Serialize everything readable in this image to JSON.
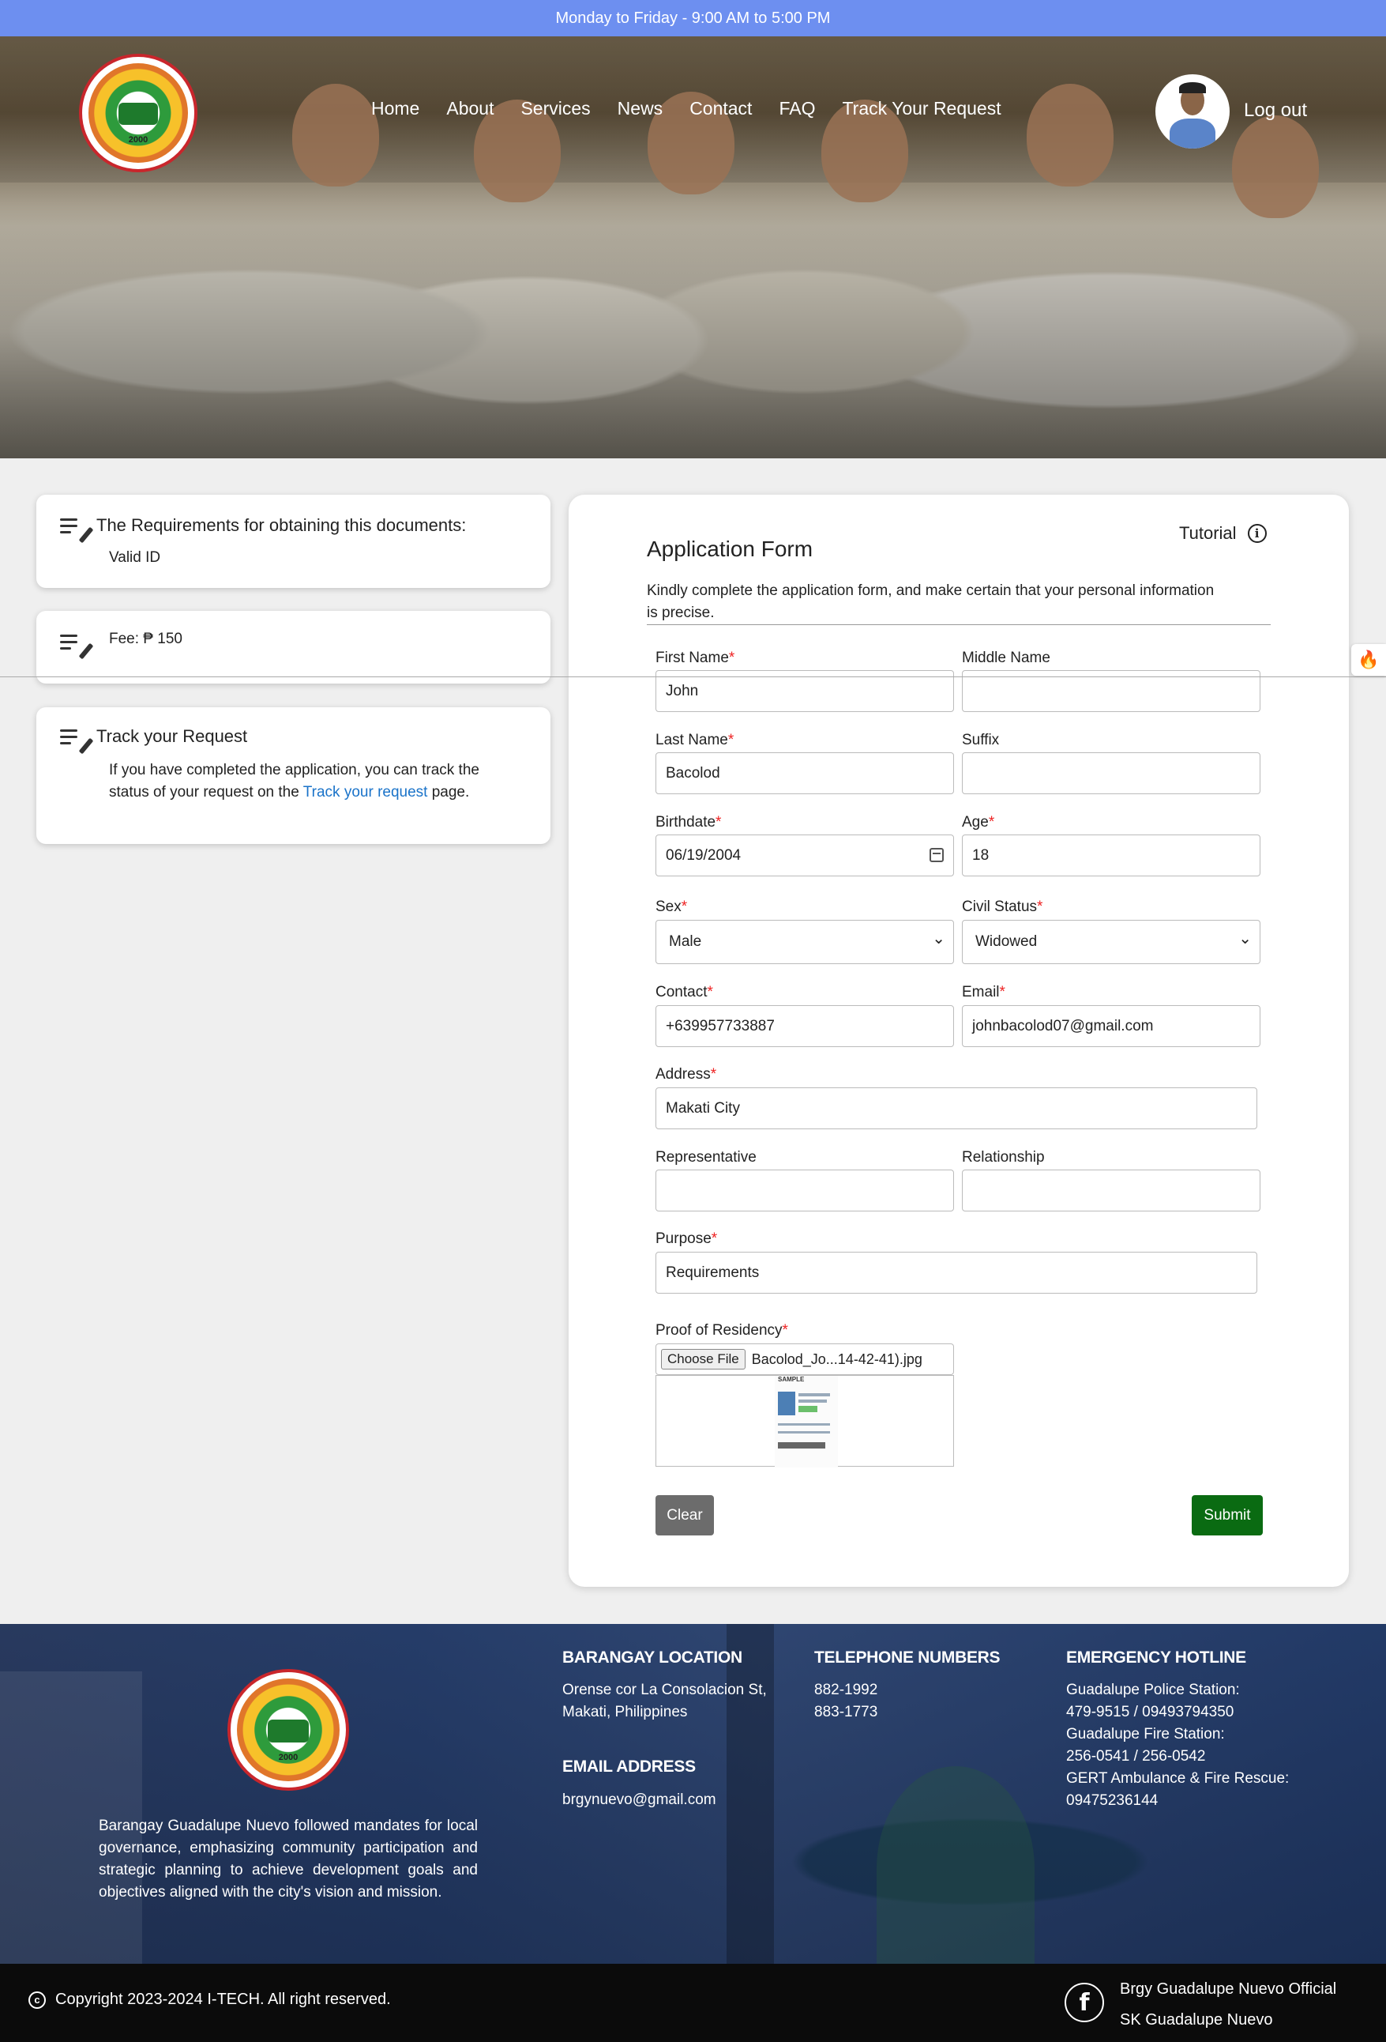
{
  "topbar": {
    "hours": "Monday to Friday - 9:00 AM to 5:00 PM"
  },
  "header": {
    "logo_text": "BARANGAY GUADALUPE NUEVO · CITY OF MAKATI",
    "logo_year": "2000",
    "nav": [
      "Home",
      "About",
      "Services",
      "News",
      "Contact",
      "FAQ",
      "Track Your Request"
    ],
    "logout": "Log out"
  },
  "sidebar": {
    "requirements_title": "The Requirements for obtaining this documents:",
    "requirements_item": "Valid ID",
    "fee": "Fee: ₱ 150",
    "track_title": "Track your Request",
    "track_text_before": "If you have completed the application, you can track the status of your request on the ",
    "track_link": "Track your request",
    "track_text_after": " page."
  },
  "form": {
    "title": "Application Form",
    "description": "Kindly complete the application form, and make certain that your personal information is precise.",
    "tutorial": "Tutorial",
    "labels": {
      "first_name": "First Name",
      "middle_name": "Middle Name",
      "last_name": "Last Name",
      "suffix": "Suffix",
      "birthdate": "Birthdate",
      "age": "Age",
      "sex": "Sex",
      "civil_status": "Civil Status",
      "contact": "Contact",
      "email": "Email",
      "address": "Address",
      "representative": "Representative",
      "relationship": "Relationship",
      "purpose": "Purpose",
      "proof": "Proof of Residency"
    },
    "values": {
      "first_name": "John",
      "middle_name": "",
      "last_name": "Bacolod",
      "suffix": "",
      "birthdate": "06/19/2004",
      "age": "18",
      "sex": "Male",
      "civil_status": "Widowed",
      "contact": "+639957733887",
      "email": "johnbacolod07@gmail.com",
      "address": "Makati City",
      "representative": "",
      "relationship": "",
      "purpose": "Requirements"
    },
    "required_mark": "*",
    "choose_file": "Choose File",
    "file_name": "Bacolod_Jo...14-42-41).jpg",
    "preview_label": "SAMPLE",
    "clear": "Clear",
    "submit": "Submit"
  },
  "footer": {
    "about": "Barangay Guadalupe Nuevo followed mandates for local governance, emphasizing community participation and strategic planning to achieve development goals and objectives aligned with the city's vision and mission.",
    "location_title": "BARANGAY LOCATION",
    "location_line1": "Orense cor La Consolacion St,",
    "location_line2": "Makati, Philippines",
    "email_title": "EMAIL ADDRESS",
    "email": "brgynuevo@gmail.com",
    "tel_title": "TELEPHONE NUMBERS",
    "tel1": "882-1992",
    "tel2": "883-1773",
    "emergency_title": "EMERGENCY HOTLINE",
    "police_label": "Guadalupe Police Station:",
    "police_numbers": "479-9515 / 09493794350",
    "fire_label": "Guadalupe Fire Station:",
    "fire_numbers": "256-0541 / 256-0542",
    "gert_label": "GERT Ambulance & Fire Rescue:",
    "gert_number": "09475236144",
    "copyright": "Copyright 2023-2024 I-TECH. All right reserved.",
    "social1": "Brgy Guadalupe Nuevo Official",
    "social2": "SK Guadalupe Nuevo"
  },
  "colors": {
    "topbar": "#6d8ff0",
    "link": "#1a73c9",
    "clear_button": "#6c6c6c",
    "submit_button": "#0a6b12",
    "required": "#e22222"
  }
}
